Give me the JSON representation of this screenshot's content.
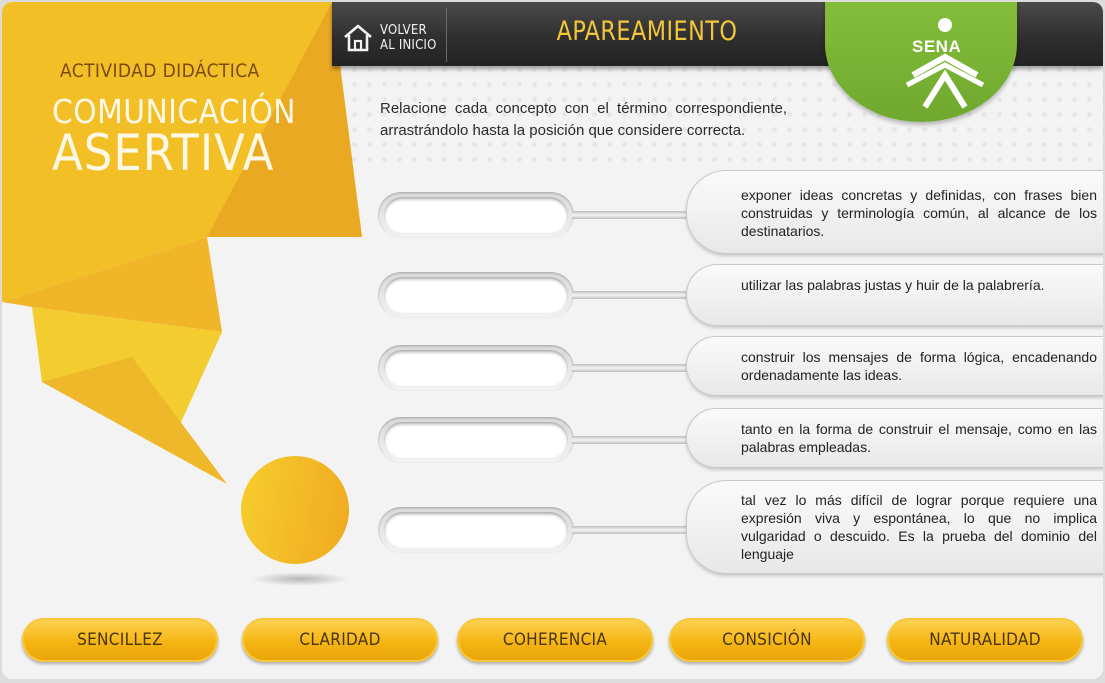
{
  "header": {
    "home_label": "VOLVER\nAL INICIO",
    "title": "APAREAMIENTO",
    "logo_text": "SENA"
  },
  "brand": {
    "kicker": "ACTIVIDAD DIDÁCTICA",
    "title_line1": "COMUNICACIÓN",
    "title_line2": "ASERTIVA"
  },
  "instruction": "Relacione cada concepto con el término correspondiente, arrastrándolo hasta la posición que considere correcta.",
  "definitions": [
    "exponer ideas concretas y definidas, con frases bien construidas y terminología común, al alcance de los destinatarios.",
    "utilizar las palabras justas y huir de la palabrería.",
    "construir los mensajes de forma lógica, encadenando ordenadamente las ideas.",
    "tanto en la forma de construir el mensaje, como en las palabras empleadas.",
    "tal vez lo más difícil de lograr porque requiere una expresión viva y espontánea, lo que no implica vulgaridad o descuido. Es la prueba del dominio del lenguaje"
  ],
  "answers": [
    "SENCILLEZ",
    "CLARIDAD",
    "COHERENCIA",
    "CONSICIÓN",
    "NATURALIDAD"
  ],
  "colors": {
    "accent_yellow": "#f4b512",
    "title_yellow": "#f4c63a",
    "sena_green": "#7ab534",
    "bar_dark": "#2d2d2d"
  },
  "icons": {
    "home": "home-icon",
    "logo": "sena-logo-icon"
  }
}
